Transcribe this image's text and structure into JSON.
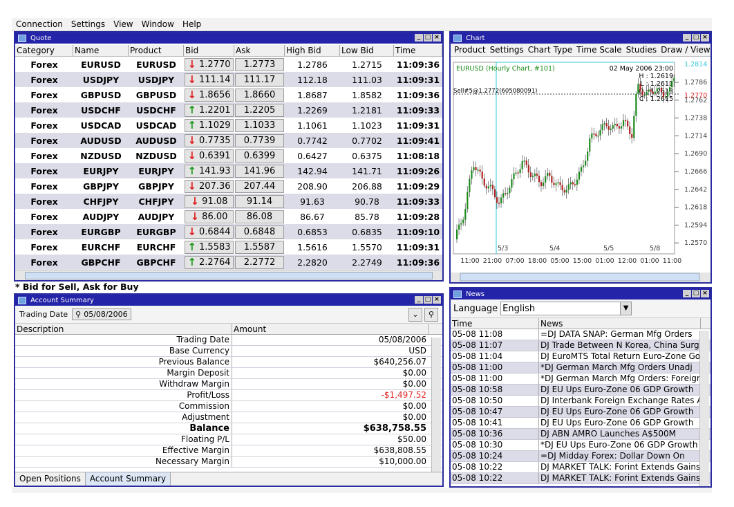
{
  "menubar": [
    "Connection",
    "Settings",
    "View",
    "Window",
    "Help"
  ],
  "quote": {
    "title": "Quote",
    "columns": [
      "Category",
      "Name",
      "Product",
      "Bid",
      "Ask",
      "High Bid",
      "Low Bid",
      "Time"
    ],
    "rows": [
      {
        "category": "Forex",
        "name": "EURUSD",
        "product": "EURUSD",
        "dir": "down",
        "bid": "1.2770",
        "ask": "1.2773",
        "high": "1.2786",
        "low": "1.2715",
        "time": "11:09:36"
      },
      {
        "category": "Forex",
        "name": "USDJPY",
        "product": "USDJPY",
        "dir": "down",
        "bid": "111.14",
        "ask": "111.17",
        "high": "112.18",
        "low": "111.03",
        "time": "11:09:31"
      },
      {
        "category": "Forex",
        "name": "GBPUSD",
        "product": "GBPUSD",
        "dir": "down",
        "bid": "1.8656",
        "ask": "1.8660",
        "high": "1.8687",
        "low": "1.8582",
        "time": "11:09:36"
      },
      {
        "category": "Forex",
        "name": "USDCHF",
        "product": "USDCHF",
        "dir": "up",
        "bid": "1.2201",
        "ask": "1.2205",
        "high": "1.2269",
        "low": "1.2181",
        "time": "11:09:33"
      },
      {
        "category": "Forex",
        "name": "USDCAD",
        "product": "USDCAD",
        "dir": "up",
        "bid": "1.1029",
        "ask": "1.1033",
        "high": "1.1061",
        "low": "1.1023",
        "time": "11:09:31"
      },
      {
        "category": "Forex",
        "name": "AUDUSD",
        "product": "AUDUSD",
        "dir": "down",
        "bid": "0.7735",
        "ask": "0.7739",
        "high": "0.7742",
        "low": "0.7702",
        "time": "11:09:41"
      },
      {
        "category": "Forex",
        "name": "NZDUSD",
        "product": "NZDUSD",
        "dir": "down",
        "bid": "0.6391",
        "ask": "0.6399",
        "high": "0.6427",
        "low": "0.6375",
        "time": "11:08:18"
      },
      {
        "category": "Forex",
        "name": "EURJPY",
        "product": "EURJPY",
        "dir": "up",
        "bid": "141.93",
        "ask": "141.96",
        "high": "142.94",
        "low": "141.71",
        "time": "11:09:26"
      },
      {
        "category": "Forex",
        "name": "GBPJPY",
        "product": "GBPJPY",
        "dir": "down",
        "bid": "207.36",
        "ask": "207.44",
        "high": "208.90",
        "low": "206.88",
        "time": "11:09:29"
      },
      {
        "category": "Forex",
        "name": "CHFJPY",
        "product": "CHFJPY",
        "dir": "down",
        "bid": "91.08",
        "ask": "91.14",
        "high": "91.63",
        "low": "90.78",
        "time": "11:09:33"
      },
      {
        "category": "Forex",
        "name": "AUDJPY",
        "product": "AUDJPY",
        "dir": "down",
        "bid": "86.00",
        "ask": "86.08",
        "high": "86.67",
        "low": "85.78",
        "time": "11:09:28"
      },
      {
        "category": "Forex",
        "name": "EURGBP",
        "product": "EURGBP",
        "dir": "down",
        "bid": "0.6844",
        "ask": "0.6848",
        "high": "0.6853",
        "low": "0.6835",
        "time": "11:09:10"
      },
      {
        "category": "Forex",
        "name": "EURCHF",
        "product": "EURCHF",
        "dir": "up",
        "bid": "1.5583",
        "ask": "1.5587",
        "high": "1.5616",
        "low": "1.5570",
        "time": "11:09:31"
      },
      {
        "category": "Forex",
        "name": "GBPCHF",
        "product": "GBPCHF",
        "dir": "up",
        "bid": "2.2764",
        "ask": "2.2772",
        "high": "2.2820",
        "low": "2.2749",
        "time": "11:09:36"
      }
    ],
    "note": "* Bid for Sell, Ask for Buy"
  },
  "account": {
    "title": "Account Summary",
    "trading_date_label": "Trading Date",
    "trading_date": "05/08/2006",
    "columns": [
      "Description",
      "Amount"
    ],
    "rows": [
      {
        "desc": "Trading Date",
        "amount": "05/08/2006",
        "neg": false,
        "bold": false
      },
      {
        "desc": "Base Currency",
        "amount": "USD",
        "neg": false,
        "bold": false
      },
      {
        "desc": "Previous Balance",
        "amount": "$640,256.07",
        "neg": false,
        "bold": false
      },
      {
        "desc": "Margin Deposit",
        "amount": "$0.00",
        "neg": false,
        "bold": false
      },
      {
        "desc": "Withdraw Margin",
        "amount": "$0.00",
        "neg": false,
        "bold": false
      },
      {
        "desc": "Profit/Loss",
        "amount": "-$1,497.52",
        "neg": true,
        "bold": false
      },
      {
        "desc": "Commission",
        "amount": "$0.00",
        "neg": false,
        "bold": false
      },
      {
        "desc": "Adjustment",
        "amount": "$0.00",
        "neg": false,
        "bold": false
      },
      {
        "desc": "Balance",
        "amount": "$638,758.55",
        "neg": false,
        "bold": true
      },
      {
        "desc": "Floating P/L",
        "amount": "$50.00",
        "neg": false,
        "bold": false
      },
      {
        "desc": "Effective Margin",
        "amount": "$638,808.55",
        "neg": false,
        "bold": false
      },
      {
        "desc": "Necessary Margin",
        "amount": "$10,000.00",
        "neg": false,
        "bold": false
      }
    ],
    "tabs": [
      "Open Positions",
      "Account Summary"
    ]
  },
  "chart": {
    "title": "Chart",
    "menu": [
      "Product",
      "Settings",
      "Chart Type",
      "Time Scale",
      "Studies",
      "Draw / View"
    ],
    "header_left": "EURUSD (Hourly Chart, #101)",
    "header_date": "02 May 2006 23:00",
    "ohlc": [
      "H : 1.2619",
      "L : 1.2611",
      "O : 1.2613",
      "C : 1.2615"
    ],
    "position_label": "Sell#5@1.2772(605080091)",
    "top_price": "1.2814",
    "current_price": "1.2770",
    "y_ticks": [
      "1.2786",
      "1.2762",
      "1.2738",
      "1.2714",
      "1.2690",
      "1.2666",
      "1.2642",
      "1.2618",
      "1.2594",
      "1.2570"
    ],
    "date_labels": [
      "5/3",
      "5/4",
      "5/5",
      "5/8"
    ],
    "x_ticks": [
      "11:00",
      "21:00",
      "07:00",
      "18:00",
      "05:00",
      "15:00",
      "01:00",
      "12:00",
      "01:00",
      "11:00"
    ]
  },
  "news": {
    "title": "News",
    "language_label": "Language",
    "language": "English",
    "columns": [
      "Time",
      "News"
    ],
    "rows": [
      {
        "time": "05-08 11:08",
        "headline": "=DJ DATA SNAP: German Mfg Orders"
      },
      {
        "time": "05-08 11:07",
        "headline": "DJ Trade Between N Korea, China Surges"
      },
      {
        "time": "05-08 11:04",
        "headline": "DJ EuroMTS Total Return Euro-Zone Govt"
      },
      {
        "time": "05-08 11:00",
        "headline": "*DJ German March Mfg Orders Unadj"
      },
      {
        "time": "05-08 11:00",
        "headline": "*DJ German March Mfg Orders: Foreign"
      },
      {
        "time": "05-08 10:58",
        "headline": "DJ EU Ups Euro-Zone 06 GDP Growth"
      },
      {
        "time": "05-08 10:50",
        "headline": "DJ Interbank Foreign Exchange Rates At"
      },
      {
        "time": "05-08 10:47",
        "headline": "DJ EU Ups Euro-Zone 06 GDP Growth"
      },
      {
        "time": "05-08 10:41",
        "headline": "DJ EU Ups Euro-Zone 06 GDP Growth"
      },
      {
        "time": "05-08 10:36",
        "headline": "DJ ABN AMRO Launches A$500M"
      },
      {
        "time": "05-08 10:30",
        "headline": "*DJ EU Ups Euro-Zone 06 GDP Growth"
      },
      {
        "time": "05-08 10:24",
        "headline": "=DJ Midday Forex: Dollar Down On"
      },
      {
        "time": "05-08 10:22",
        "headline": "DJ MARKET TALK: Forint Extends Gains Vs"
      },
      {
        "time": "05-08 10:22",
        "headline": "DJ MARKET TALK: Forint Extends Gains Vs"
      }
    ]
  },
  "colors": {
    "titlebar": "#2424a8",
    "down": "#e02020",
    "up": "#1a9a1a",
    "row_alt": "#dcdce8",
    "candle_up": "#1a8a1a",
    "candle_down": "#b02020"
  }
}
